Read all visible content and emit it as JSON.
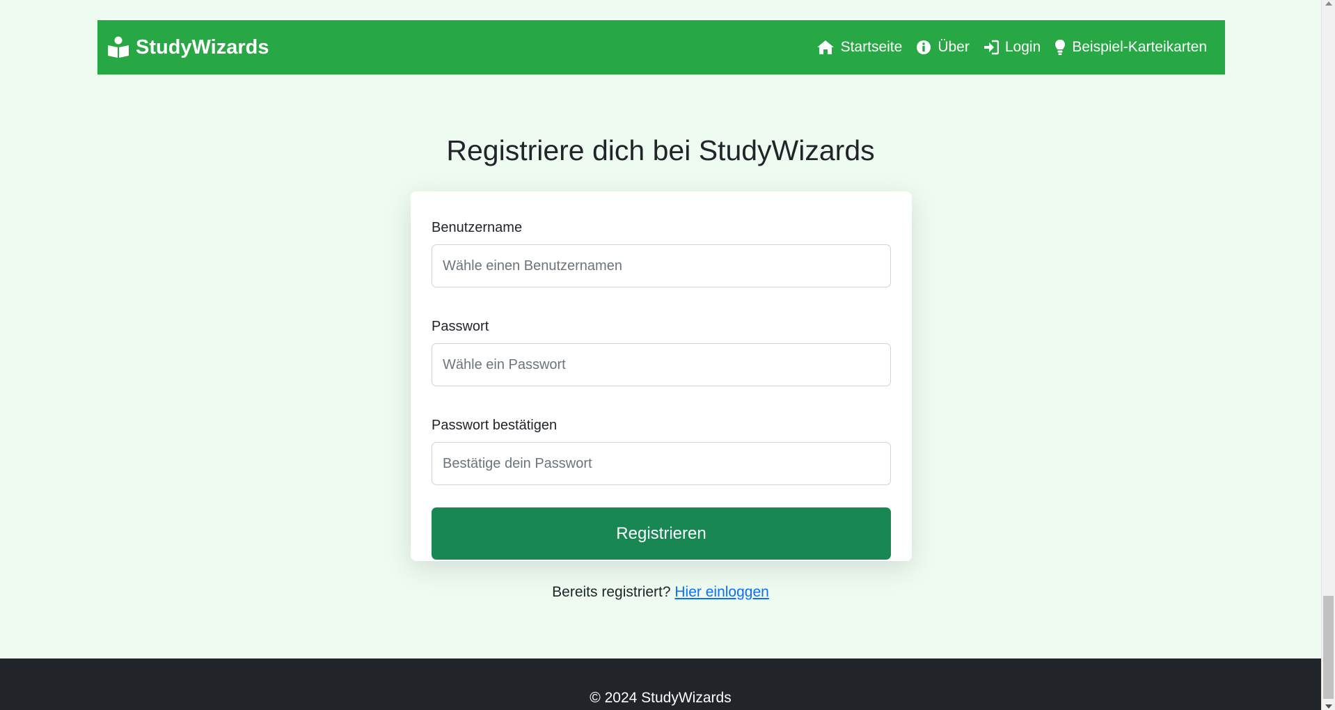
{
  "navbar": {
    "brand": "StudyWizards",
    "brand_icon": "book-reader-icon",
    "links": [
      {
        "label": "Startseite",
        "icon": "home-icon"
      },
      {
        "label": "Über",
        "icon": "info-circle-icon"
      },
      {
        "label": "Login",
        "icon": "sign-in-icon"
      },
      {
        "label": "Beispiel-Karteikarten",
        "icon": "lightbulb-icon"
      }
    ],
    "color": "#28a745"
  },
  "page_title": "Registriere dich bei StudyWizards",
  "form": {
    "username": {
      "label": "Benutzername",
      "placeholder": "Wähle einen Benutzernamen",
      "value": ""
    },
    "password": {
      "label": "Passwort",
      "placeholder": "Wähle ein Passwort",
      "value": ""
    },
    "password_confirm": {
      "label": "Passwort bestätigen",
      "placeholder": "Bestätige dein Passwort",
      "value": ""
    },
    "submit_label": "Registrieren",
    "submit_color": "#198754"
  },
  "login_prompt": {
    "text": "Bereits registriert?",
    "link": "Hier einloggen"
  },
  "footer": {
    "copyright": "© 2024 StudyWizards"
  }
}
